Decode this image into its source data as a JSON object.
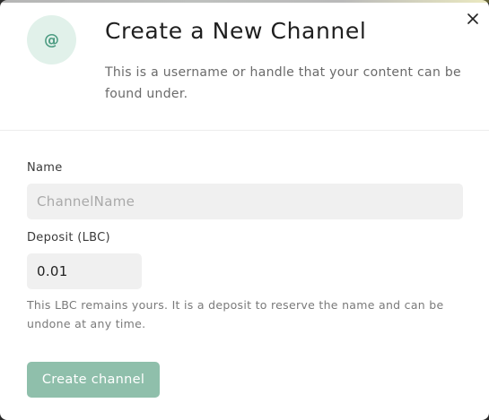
{
  "modal": {
    "avatar_symbol": "@",
    "title": "Create a New Channel",
    "subtitle": "This is a username or handle that your content can be found under.",
    "close_icon": "close-icon"
  },
  "form": {
    "name_label": "Name",
    "name_placeholder": "ChannelName",
    "name_value": "",
    "deposit_label": "Deposit (LBC)",
    "deposit_value": "0.01",
    "deposit_help": "This LBC remains yours. It is a deposit to reserve the name and can be undone at any time.",
    "submit_label": "Create channel"
  },
  "colors": {
    "accent": "#8fbfab",
    "avatar_bg": "#e1f1ea",
    "avatar_fg": "#4d9c82",
    "input_bg": "#f0f0f0"
  }
}
